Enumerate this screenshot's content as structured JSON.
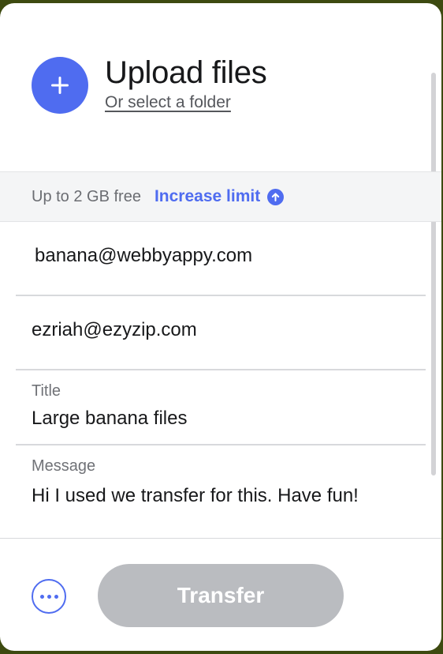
{
  "upload": {
    "title": "Upload files",
    "folder_link": "Or select a folder"
  },
  "limit": {
    "text": "Up to 2 GB free",
    "increase_label": "Increase limit"
  },
  "form": {
    "email_to": "banana@webbyappy.com",
    "email_from": "ezriah@ezyzip.com",
    "title_label": "Title",
    "title_value": "Large banana files",
    "message_label": "Message",
    "message_value": "Hi I used we transfer for this. Have fun!"
  },
  "footer": {
    "transfer_label": "Transfer"
  },
  "colors": {
    "accent": "#4f6cf0",
    "disabled_button": "#babcc0",
    "background_outer": "#3d4a10"
  },
  "icons": {
    "add": "plus-icon",
    "increase": "arrow-up-circle-icon",
    "more": "more-options-icon"
  }
}
